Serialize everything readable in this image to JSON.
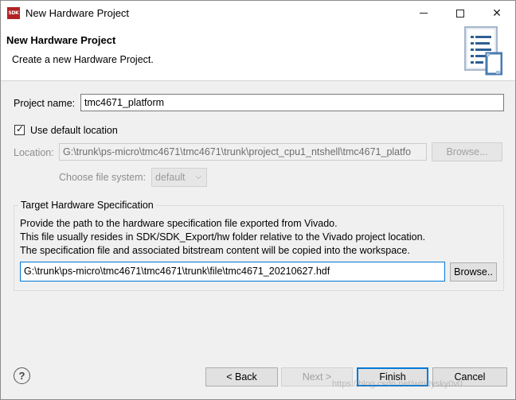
{
  "window": {
    "title": "New Hardware Project",
    "icon_text": "SDK",
    "minimize_icon": "minimize-icon",
    "maximize_icon": "maximize-icon",
    "close_glyph": "✕"
  },
  "banner": {
    "title": "New Hardware Project",
    "description": "Create a new Hardware Project.",
    "icon": "wizard-banner-icon"
  },
  "project": {
    "name_label": "Project name:",
    "name_value": "tmc4671_platform",
    "use_default_label": "Use default location",
    "use_default_checked": true,
    "location_label": "Location:",
    "location_value": "G:\\trunk\\ps-micro\\tmc4671\\tmc4671\\trunk\\project_cpu1_ntshell\\tmc4671_platfo",
    "location_browse": "Browse...",
    "filesystem_label": "Choose file system:",
    "filesystem_value": "default"
  },
  "hw_spec": {
    "group_title": "Target Hardware Specification",
    "line1": "Provide the path to the hardware specification file exported from Vivado.",
    "line2": "This file usually resides in SDK/SDK_Export/hw folder relative to the Vivado project location.",
    "line3": "The specification file and associated bitstream content will be copied into the workspace.",
    "path_value": "G:\\trunk\\ps-micro\\tmc4671\\tmc4671\\trunk\\file\\tmc4671_20210627.hdf",
    "browse": "Browse.."
  },
  "footer": {
    "help_glyph": "?",
    "back": "< Back",
    "next": "Next >",
    "finish": "Finish",
    "cancel": "Cancel"
  },
  "watermark": "https://blog.csdn.net/windysky0v0",
  "colors": {
    "accent": "#0078d7",
    "window_bg": "#f0f0f0",
    "banner_bg": "#ffffff",
    "disabled_text": "#8d8d8d"
  }
}
